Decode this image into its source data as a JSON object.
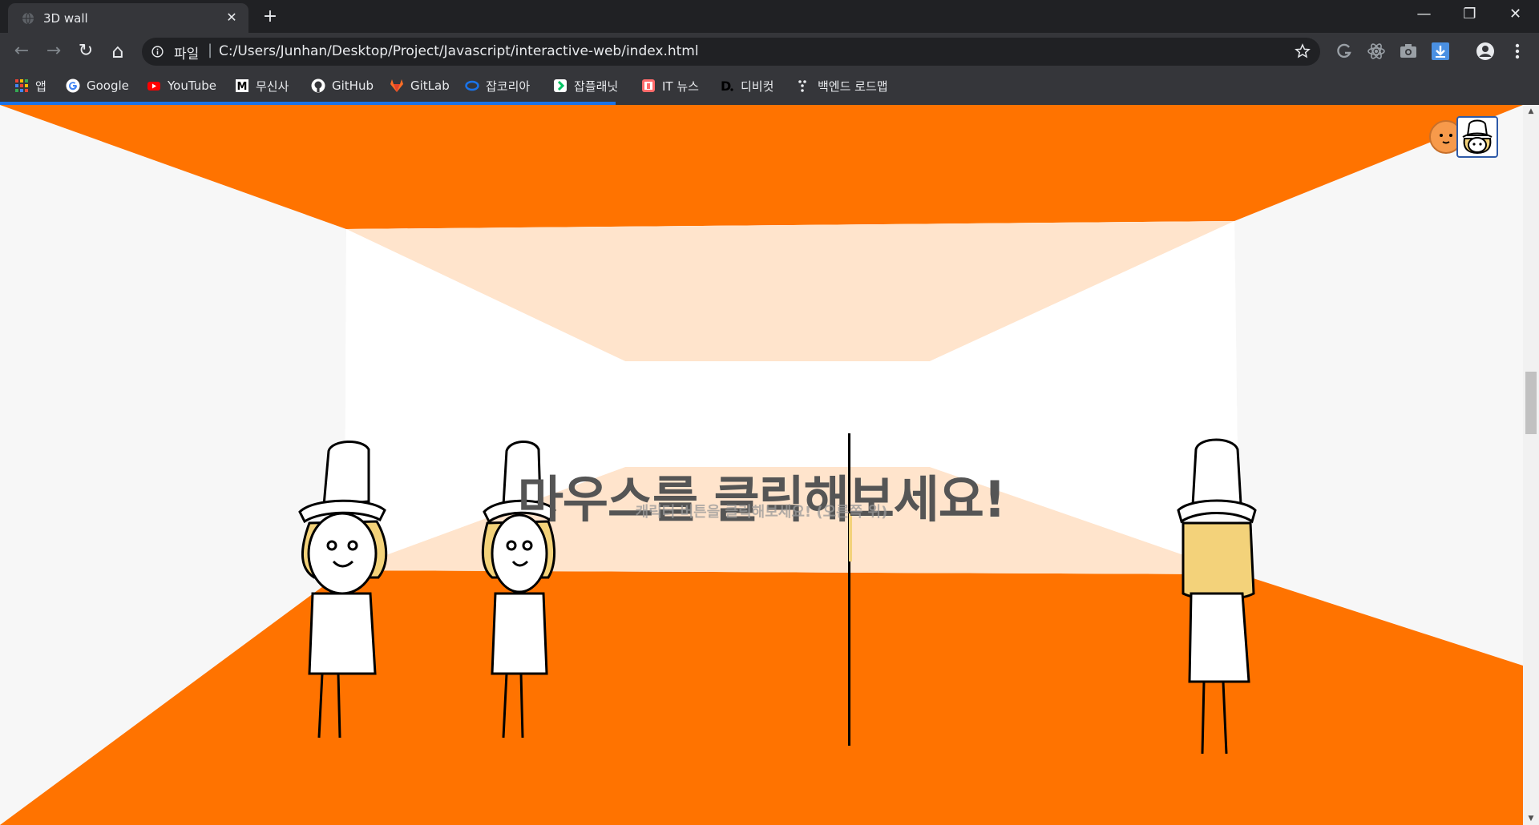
{
  "browser": {
    "tab_title": "3D wall",
    "tab_close": "✕",
    "new_tab": "+",
    "window_controls": {
      "minimize": "—",
      "restore": "❐",
      "close": "✕"
    },
    "nav": {
      "back": "←",
      "forward": "→",
      "reload": "↻",
      "home": "⌂"
    },
    "scheme_label": "파일",
    "url_separator": "|",
    "url": "C:/Users/Junhan/Desktop/Project/Javascript/interactive-web/index.html",
    "load_progress_percent": 40,
    "extensions": [
      "grammarly-icon",
      "react-devtools-icon",
      "camera-icon",
      "download-icon",
      "profile-icon",
      "menu-dots-icon"
    ],
    "bookmarks": [
      {
        "label": "앱",
        "icon": "apps-grid-icon"
      },
      {
        "label": "Google",
        "icon": "google-icon"
      },
      {
        "label": "YouTube",
        "icon": "youtube-icon"
      },
      {
        "label": "무신사",
        "icon": "musinsa-icon"
      },
      {
        "label": "GitHub",
        "icon": "github-icon"
      },
      {
        "label": "GitLab",
        "icon": "gitlab-icon"
      },
      {
        "label": "잡코리아",
        "icon": "jobkorea-icon"
      },
      {
        "label": "잡플래닛",
        "icon": "jobplanet-icon"
      },
      {
        "label": "IT 뉴스",
        "icon": "it-news-icon"
      },
      {
        "label": "디비컷",
        "icon": "dbcut-icon"
      },
      {
        "label": "백엔드 로드맵",
        "icon": "roadmap-icon"
      }
    ]
  },
  "page": {
    "headline": "마우스를 클릭해보세요!",
    "subline": "캐릭터 버튼을 클릭해보세요! (오른쪽 위)",
    "colors": {
      "wall": "#ff7300",
      "wall_light": "#ffe4cc",
      "background": "#f7f7f7",
      "text": "#555555"
    },
    "character_select": [
      {
        "name": "orange-character-button",
        "color": "#f79a4b"
      },
      {
        "name": "bucket-hat-character-button",
        "color": "#ffffff"
      }
    ],
    "characters": [
      "bucket-hat-character-1",
      "bucket-hat-character-2",
      "bucket-hat-character-3-sideways",
      "bucket-hat-character-4-back"
    ]
  }
}
